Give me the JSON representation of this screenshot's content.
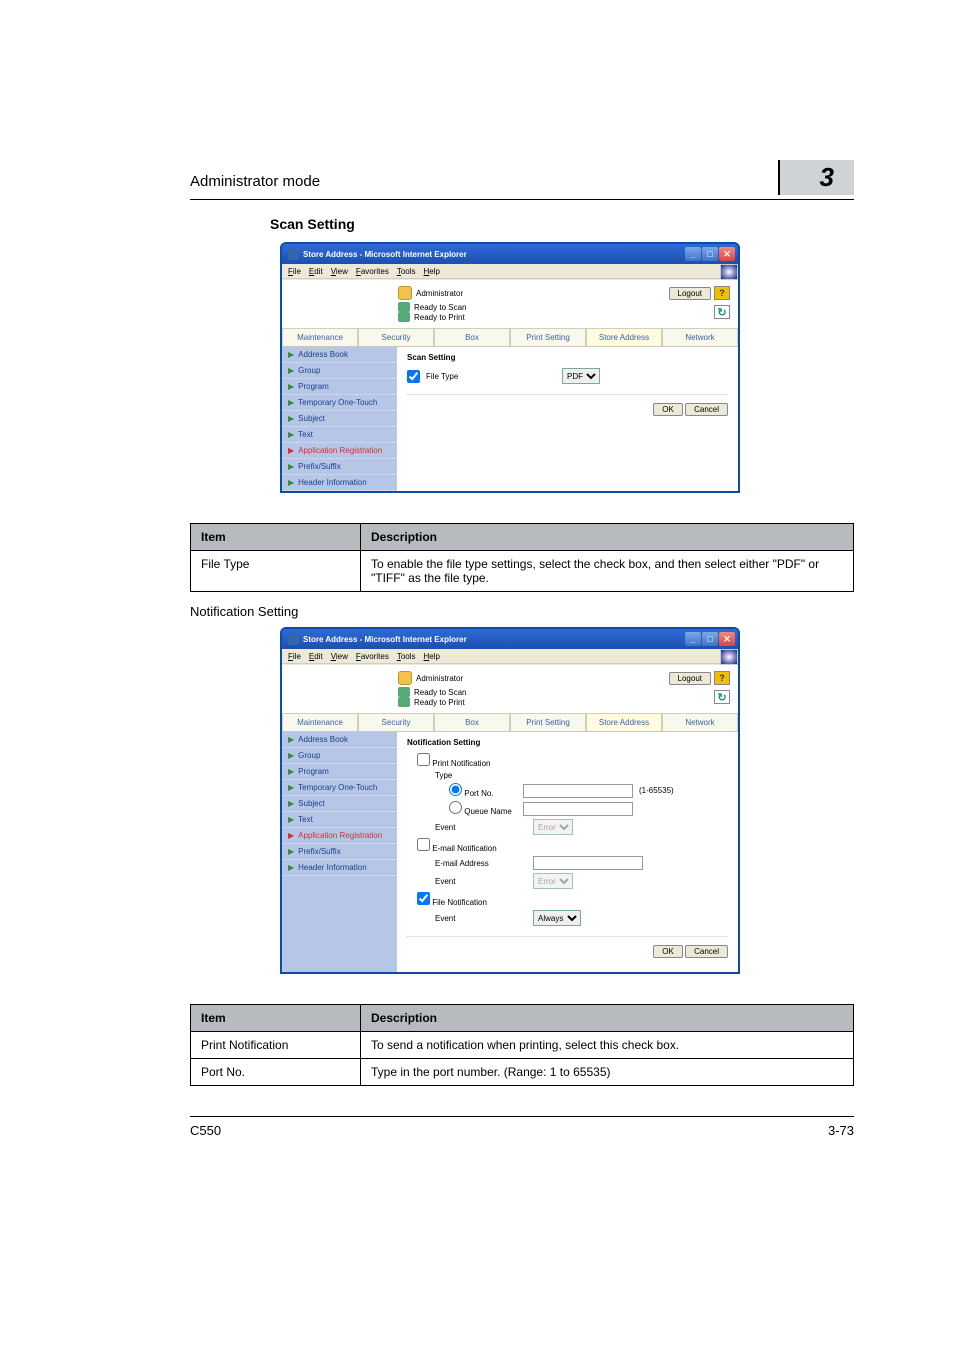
{
  "header": {
    "title": "Administrator mode",
    "chapter": "3"
  },
  "section1_title": "Scan Setting",
  "section2_title": "Notification Setting",
  "ie": {
    "title": "Store Address - Microsoft Internet Explorer",
    "menu": {
      "file": "File",
      "edit": "Edit",
      "view": "View",
      "favorites": "Favorites",
      "tools": "Tools",
      "help": "Help"
    }
  },
  "admin": {
    "mode_label": "Administrator",
    "logout": "Logout",
    "status_scan": "Ready to Scan",
    "status_print": "Ready to Print"
  },
  "tabs": {
    "maintenance": "Maintenance",
    "security": "Security",
    "box": "Box",
    "print": "Print Setting",
    "store": "Store Address",
    "network": "Network"
  },
  "sidebar": {
    "address_book": "Address Book",
    "group": "Group",
    "program": "Program",
    "temp": "Temporary One-Touch",
    "subject": "Subject",
    "text": "Text",
    "appreg": "Application Registration",
    "prefix": "Prefix/Suffix",
    "header": "Header Information"
  },
  "scan_form": {
    "title": "Scan Setting",
    "file_type": "File Type",
    "file_type_value": "PDF",
    "ok": "OK",
    "cancel": "Cancel"
  },
  "notif_form": {
    "title": "Notification Setting",
    "print_notif": "Print Notification",
    "type": "Type",
    "port_no": "Port No.",
    "port_range": "(1-65535)",
    "queue": "Queue Name",
    "event": "Event",
    "error": "Error",
    "email_notif": "E-mail Notification",
    "email_addr": "E-mail Address",
    "file_notif": "File Notification",
    "always": "Always",
    "ok": "OK",
    "cancel": "Cancel"
  },
  "table1": {
    "h0": "Item",
    "h1": "Description",
    "r0c0": "File Type",
    "r0c1": "To enable the file type settings, select the check box, and then select either \"PDF\" or \"TIFF\" as the file type."
  },
  "table2": {
    "h0": "Item",
    "h1": "Description",
    "r0c0": "Print Notification",
    "r0c1": "To send a notification when printing, select this check box.",
    "r1c0": "Port No.",
    "r1c1": "Type in the port number. (Range: 1 to 65535)"
  },
  "footer": {
    "model": "C550",
    "page": "3-73"
  }
}
